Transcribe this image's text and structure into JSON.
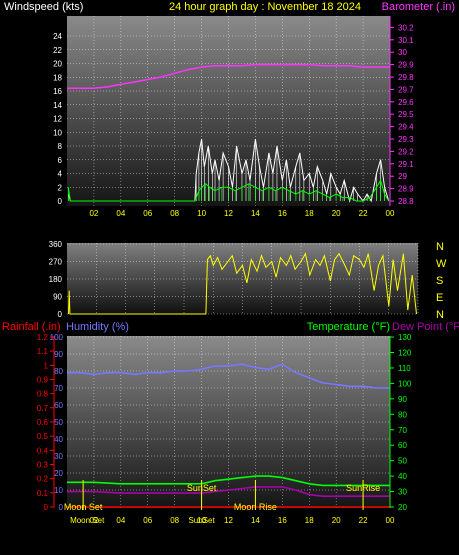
{
  "header": {
    "left_label": "Windspeed (kts)",
    "title": "24 hour graph day : November 18 2024",
    "right_label": "Barometer (.in)"
  },
  "colors": {
    "background": "#000000",
    "wind": "#ffffff",
    "gust": "#00ff00",
    "barometer": "#ff33ff",
    "direction": "#ffff00",
    "rain": "#ff0000",
    "humidity": "#7777ff",
    "temperature": "#00ff00",
    "dewpoint": "#aa00aa"
  },
  "chart_data": [
    {
      "type": "line",
      "title": "24 hour graph day : November 18 2024",
      "xlabel": "",
      "x_tick_labels": [
        "02",
        "04",
        "06",
        "08",
        "10",
        "12",
        "14",
        "16",
        "18",
        "20",
        "22",
        "00"
      ],
      "x_range": [
        0,
        24
      ],
      "grid": true,
      "y_left": {
        "label": "Windspeed (kts)",
        "range": [
          0,
          25
        ],
        "ticks": [
          0,
          2,
          4,
          6,
          8,
          10,
          12,
          14,
          16,
          18,
          20,
          22,
          24
        ]
      },
      "y_right": {
        "label": "Barometer (.in)",
        "range": [
          29.75,
          30.25
        ],
        "ticks": [
          "28.8",
          "28.9",
          "29",
          "29.1",
          "29.2",
          "29.3",
          "29.4",
          "29.5",
          "29.6",
          "29.7",
          "29.8",
          "29.9",
          "30",
          "30.1",
          "30.2"
        ]
      },
      "series": [
        {
          "name": "Barometer (.in)",
          "axis": "right",
          "x": [
            0,
            2,
            3,
            4,
            5,
            6,
            7,
            8,
            9,
            10,
            11,
            12,
            13,
            14,
            15,
            16,
            17,
            18,
            19,
            20,
            21,
            22,
            23,
            24
          ],
          "values": [
            29.71,
            29.71,
            29.72,
            29.74,
            29.76,
            29.78,
            29.8,
            29.83,
            29.86,
            29.88,
            29.89,
            29.89,
            29.89,
            29.9,
            29.9,
            29.9,
            29.9,
            29.9,
            29.89,
            29.89,
            29.89,
            29.88,
            29.88,
            29.88
          ]
        },
        {
          "name": "Windspeed",
          "axis": "left",
          "x": [
            0.1,
            0.25,
            9.5,
            9.6,
            9.8,
            10,
            10.2,
            10.5,
            10.8,
            11,
            11.3,
            11.6,
            12,
            12.3,
            12.6,
            13,
            13.3,
            13.6,
            14,
            14.3,
            14.6,
            15,
            15.3,
            15.6,
            16,
            16.3,
            16.6,
            17,
            17.3,
            17.6,
            18,
            18.3,
            18.6,
            19,
            19.3,
            19.6,
            20,
            20.3,
            20.6,
            21,
            21.3,
            21.6,
            22,
            22.3,
            22.6,
            23,
            23.3,
            23.6,
            23.9
          ],
          "values": [
            1,
            0,
            0,
            4,
            7,
            9,
            5,
            8,
            4,
            6,
            3,
            7,
            5,
            2,
            8,
            4,
            6,
            3,
            9,
            5,
            2,
            7,
            4,
            8,
            3,
            6,
            2,
            5,
            7,
            3,
            4,
            2,
            5,
            3,
            1,
            4,
            2,
            1,
            3,
            0,
            2,
            1,
            0,
            1,
            0,
            4,
            6,
            2,
            0
          ]
        },
        {
          "name": "Gust",
          "axis": "left",
          "x": [
            0.1,
            0.25,
            9.5,
            9.8,
            10,
            10.3,
            10.6,
            11,
            11.5,
            12,
            12.5,
            13,
            13.5,
            14,
            14.5,
            15,
            15.5,
            16,
            16.5,
            17,
            17.5,
            18,
            18.5,
            19,
            19.5,
            20,
            20.5,
            21,
            21.5,
            22,
            22.5,
            23,
            23.3,
            23.6,
            23.9
          ],
          "values": [
            2,
            0,
            0,
            1.5,
            2,
            2.5,
            2,
            1.5,
            2,
            2,
            1.5,
            2,
            2.5,
            2,
            1.5,
            2,
            1.5,
            2,
            1.5,
            1,
            1.5,
            1,
            1.5,
            1,
            0.5,
            1,
            0.5,
            0.5,
            0,
            0,
            0.5,
            2,
            3,
            1,
            0
          ]
        }
      ]
    },
    {
      "type": "scatter",
      "title": "",
      "y_range": [
        0,
        360
      ],
      "y_ticks": [
        0,
        90,
        180,
        270,
        360
      ],
      "direction_labels": [
        "N",
        "W",
        "S",
        "E",
        "N"
      ],
      "x_range": [
        0,
        24
      ],
      "series": [
        {
          "name": "Wind direction",
          "x": [
            0.1,
            0.15,
            0.2,
            9.5,
            9.6,
            9.8,
            10,
            10.3,
            10.6,
            11,
            11.3,
            11.6,
            12,
            12.3,
            12.6,
            13,
            13.3,
            13.6,
            14,
            14.3,
            14.6,
            15,
            15.3,
            15.6,
            16,
            16.3,
            16.6,
            17,
            17.3,
            17.6,
            18,
            18.3,
            18.6,
            19,
            19.3,
            19.6,
            20,
            20.3,
            20.6,
            21,
            21.3,
            21.6,
            22,
            22.3,
            22.6,
            23,
            23.3,
            23.6,
            23.9
          ],
          "values": [
            0,
            120,
            0,
            0,
            280,
            300,
            250,
            290,
            230,
            270,
            300,
            210,
            250,
            160,
            280,
            220,
            300,
            240,
            270,
            190,
            290,
            250,
            300,
            230,
            270,
            310,
            200,
            280,
            250,
            300,
            170,
            280,
            310,
            250,
            200,
            300,
            280,
            240,
            310,
            120,
            250,
            300,
            40,
            280,
            120,
            310,
            20,
            200,
            0
          ]
        }
      ]
    },
    {
      "type": "line",
      "title": "",
      "x_tick_labels": [
        "02",
        "04",
        "06",
        "08",
        "10",
        "12",
        "14",
        "16",
        "18",
        "20",
        "22",
        "00"
      ],
      "x_range": [
        0,
        24
      ],
      "grid": true,
      "y_left_outer": {
        "label": "Rainfall (.in)",
        "range": [
          0,
          1.2
        ],
        "ticks": [
          "0",
          "0.1",
          "0.2",
          "0.3",
          "0.4",
          "0.5",
          "0.6",
          "0.7",
          "0.8",
          "0.9",
          "1",
          "1.1",
          "1.2"
        ]
      },
      "y_left_inner": {
        "label": "Humidity (%)",
        "range": [
          0,
          100
        ],
        "ticks": [
          0,
          10,
          20,
          30,
          40,
          50,
          60,
          70,
          80,
          90,
          100
        ]
      },
      "y_right": {
        "label": "Temperature (°F)",
        "range": [
          20,
          130
        ],
        "ticks": [
          20,
          30,
          40,
          50,
          60,
          70,
          80,
          90,
          100,
          110,
          120,
          130
        ]
      },
      "right_extra_label": "Dew Point (°F)",
      "series": [
        {
          "name": "Humidity (%)",
          "axis": "humidity",
          "x": [
            0,
            1,
            2,
            3,
            4,
            5,
            6,
            7,
            8,
            9,
            10,
            11,
            12,
            13,
            14,
            15,
            16,
            17,
            18,
            19,
            20,
            21,
            22,
            23,
            24
          ],
          "values": [
            79,
            79,
            78,
            79,
            79,
            78,
            79,
            79,
            80,
            80,
            81,
            83,
            83,
            84,
            82,
            81,
            84,
            79,
            76,
            73,
            72,
            71,
            71,
            70,
            70
          ]
        },
        {
          "name": "Temperature (°F)",
          "axis": "temperature",
          "x": [
            0,
            2,
            4,
            6,
            8,
            9,
            10,
            11,
            12,
            13,
            14,
            15,
            16,
            17,
            18,
            19,
            20,
            21,
            22,
            23,
            24
          ],
          "values": [
            36,
            36,
            35,
            35,
            35,
            35,
            35,
            37,
            38,
            39,
            40,
            40,
            39,
            37,
            35,
            34,
            34,
            34,
            34,
            34,
            34
          ]
        },
        {
          "name": "Dew Point (°F)",
          "axis": "temperature",
          "x": [
            0,
            2,
            4,
            6,
            8,
            9,
            10,
            11,
            12,
            13,
            14,
            15,
            16,
            17,
            18,
            19,
            20,
            21,
            22,
            23,
            24
          ],
          "values": [
            30,
            30,
            29,
            29,
            29,
            29,
            29,
            30,
            31,
            32,
            33,
            33,
            33,
            31,
            28,
            27,
            27,
            27,
            27,
            27,
            27
          ]
        },
        {
          "name": "Rainfall (.in)",
          "axis": "rain",
          "x": [
            0,
            24
          ],
          "values": [
            0,
            0
          ]
        }
      ],
      "annotations": [
        {
          "text": "Moon Set",
          "x": 1.2,
          "row": "top"
        },
        {
          "text": "SunSet",
          "x": 10.0,
          "row": "mid"
        },
        {
          "text": "SunRise",
          "x": 22.0,
          "row": "mid"
        },
        {
          "text": "Moon Rise",
          "x": 14.0,
          "row": "top"
        }
      ],
      "bottom_labels": [
        {
          "text": "Moon Set",
          "x": 1.5
        },
        {
          "text": "SunSet",
          "x": 10.0
        }
      ]
    }
  ]
}
